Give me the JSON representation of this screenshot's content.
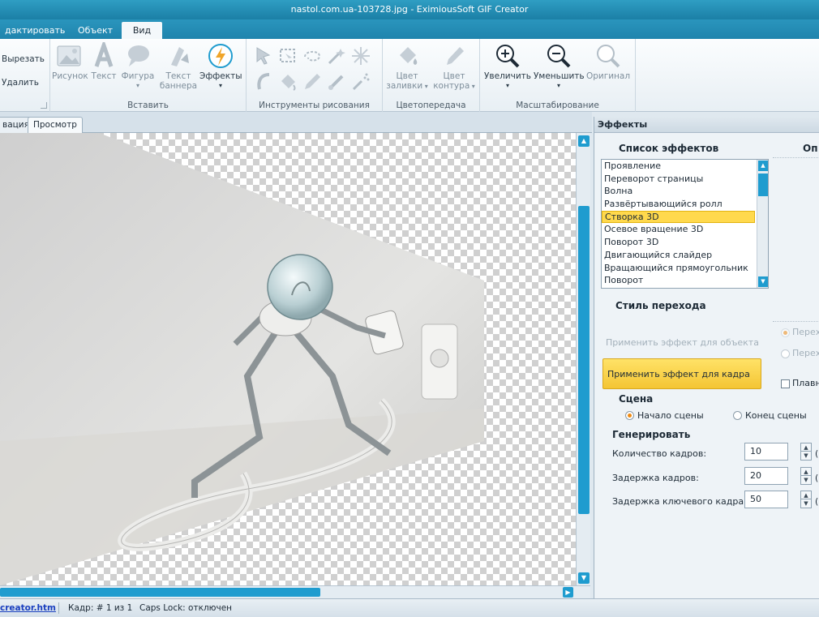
{
  "window": {
    "title": "nastol.com.ua-103728.jpg - EximiousSoft GIF Creator"
  },
  "menu": {
    "tabs": [
      "дактировать",
      "Объект",
      "Вид"
    ]
  },
  "ribbon": {
    "clipboard": {
      "cut": "Вырезать",
      "delete": "Удалить"
    },
    "insert": {
      "label": "Вставить",
      "picture": "Рисунок",
      "text": "Текст",
      "shape": "Фигура",
      "banner_text_1": "Текст",
      "banner_text_2": "баннера",
      "effects": "Эффекты"
    },
    "drawing": {
      "label": "Инструменты рисования"
    },
    "color": {
      "label": "Цветопередача",
      "fill_1": "Цвет",
      "fill_2": "заливки",
      "outline_1": "Цвет",
      "outline_2": "контура"
    },
    "zoom": {
      "label": "Масштабирование",
      "zoom_in": "Увеличить",
      "zoom_out": "Уменьшить",
      "original": "Оригинал"
    }
  },
  "doc_tabs": [
    "вация",
    "Просмотр"
  ],
  "statusbar": {
    "link": "creator.htm",
    "frame": "Кадр: # 1 из 1",
    "caps": "Caps Lock: отключен"
  },
  "panel": {
    "title": "Эффекты",
    "effects_list_title": "Список эффектов",
    "options_title": "Оп",
    "effects": [
      "Проявление",
      "Переворот страницы",
      "Волна",
      "Развёртывающийся ролл",
      "Створка 3D",
      "Осевое вращение 3D",
      "Поворот 3D",
      "Двигающийся слайдер",
      "Вращающийся прямоугольник",
      "Поворот"
    ],
    "selected_effect": "Створка 3D",
    "transition_style": "Стиль перехода",
    "apply_object": "Применить эффект для объекта",
    "apply_frame": "Применить эффект для кадра",
    "radio_1": "Перех",
    "radio_2": "Перех",
    "smooth": "Плавн",
    "scene": "Сцена",
    "scene_start": "Начало сцены",
    "scene_end": "Конец сцены",
    "generate": "Генерировать",
    "frame_count_label": "Количество кадров:",
    "frame_count": "10",
    "frame_delay_label": "Задержка кадров:",
    "frame_delay": "20",
    "key_delay_label": "Задержка ключевого кадра:",
    "key_delay": "50",
    "paren": "("
  },
  "colors": {
    "accent": "#1f9ccf",
    "highlight": "#ffd94d",
    "titlebar": "#1b7fa6"
  }
}
